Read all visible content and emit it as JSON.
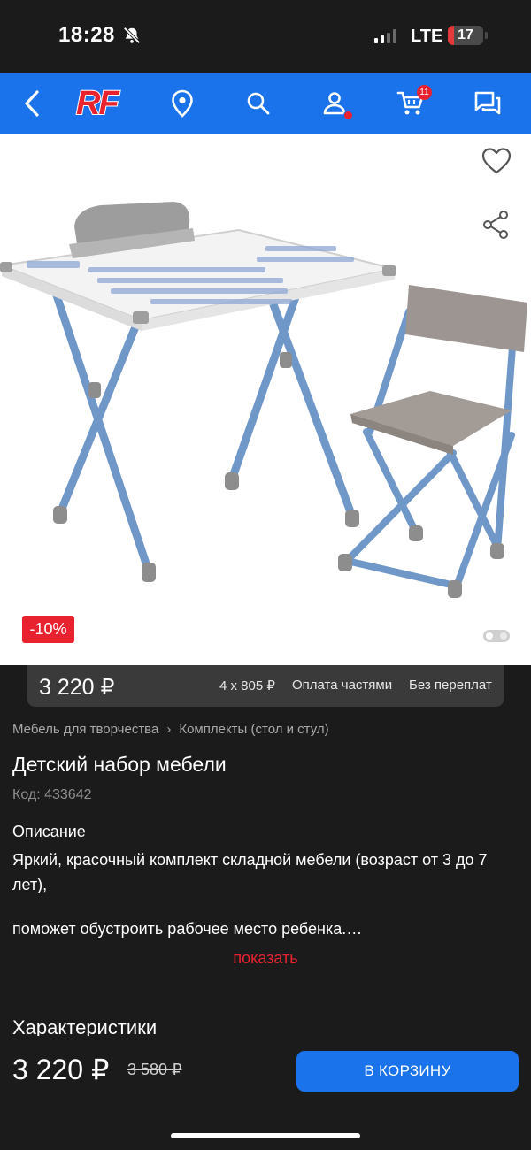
{
  "status_bar": {
    "time": "18:28",
    "network": "LTE",
    "battery_level": "17",
    "signal_bars_active": 2,
    "signal_bars_total": 4
  },
  "nav": {
    "logo_text": "RF",
    "cart_count": "11",
    "icons": [
      "back-arrow-icon",
      "location-pin-icon",
      "search-icon",
      "profile-icon",
      "cart-icon",
      "chat-icon"
    ]
  },
  "product": {
    "discount_badge": "-10%",
    "title": "Детский набор мебели",
    "code": "Код: 433642",
    "breadcrumb": [
      "Мебель для творчества",
      "Комплекты (стол и стул)"
    ],
    "gallery_images": 2,
    "gallery_active": 1
  },
  "price_strip": {
    "price": "3 220 ₽",
    "installment": "4 x 805 ₽",
    "parts_label": "Оплата частями",
    "no_fee_label": "Без переплат"
  },
  "description": {
    "heading": "Описание",
    "line1": "Яркий, красочный комплект складной мебели (возраст от 3 до 7 лет),",
    "line2": "поможет обустроить рабочее место ребенка.…",
    "show_more": "показать"
  },
  "specs_heading": "Характеристики",
  "bottom_bar": {
    "price": "3 220 ₽",
    "old_price": "3 580 ₽",
    "cart_button": "В КОРЗИНУ"
  },
  "colors": {
    "brand_blue": "#1a73ea",
    "accent_red": "#e8232f",
    "background": "#1b1b1b"
  }
}
